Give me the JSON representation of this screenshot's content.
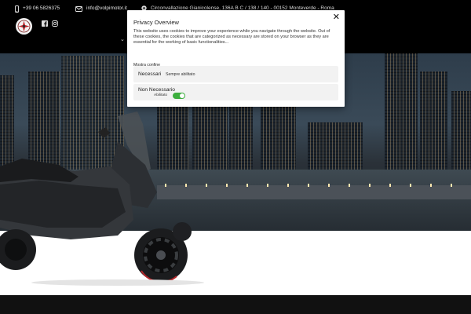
{
  "header": {
    "phone": "+39 06 5826375",
    "email": "info@volpimotor.it",
    "address": "Circonvallazione Gianicolense, 136A B C / 138 / 140 - 00152 Monteverde - Roma",
    "social": [
      "facebook-icon",
      "instagram-icon"
    ],
    "logo_colors": {
      "ring": "#f2f2f2",
      "mark": "#c4242b"
    }
  },
  "cookie_modal": {
    "title": "Privacy Overview",
    "close_label": "✕",
    "body": "This website uses cookies to improve your experience while you navigate through the website. Out of these cookies, the cookies that are categorized as necessary are stored on your browser as they are essential for the working of basic functionalities...",
    "show_less": "Mostra confine",
    "categories": [
      {
        "name": "Necessari",
        "status": "Sempre abilitato"
      },
      {
        "name": "Non Necessario",
        "status": "Abilitato",
        "enabled": true
      }
    ],
    "toggle_color": "#3cae3e"
  }
}
